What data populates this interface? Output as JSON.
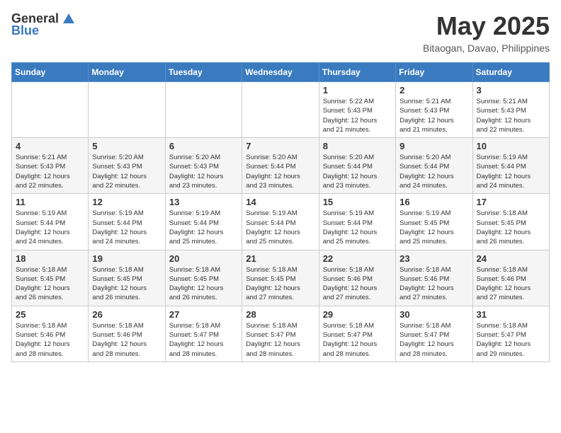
{
  "header": {
    "logo_general": "General",
    "logo_blue": "Blue",
    "month_title": "May 2025",
    "location": "Bitaogan, Davao, Philippines"
  },
  "days_of_week": [
    "Sunday",
    "Monday",
    "Tuesday",
    "Wednesday",
    "Thursday",
    "Friday",
    "Saturday"
  ],
  "weeks": [
    [
      {
        "day": "",
        "info": ""
      },
      {
        "day": "",
        "info": ""
      },
      {
        "day": "",
        "info": ""
      },
      {
        "day": "",
        "info": ""
      },
      {
        "day": "1",
        "info": "Sunrise: 5:22 AM\nSunset: 5:43 PM\nDaylight: 12 hours\nand 21 minutes."
      },
      {
        "day": "2",
        "info": "Sunrise: 5:21 AM\nSunset: 5:43 PM\nDaylight: 12 hours\nand 21 minutes."
      },
      {
        "day": "3",
        "info": "Sunrise: 5:21 AM\nSunset: 5:43 PM\nDaylight: 12 hours\nand 22 minutes."
      }
    ],
    [
      {
        "day": "4",
        "info": "Sunrise: 5:21 AM\nSunset: 5:43 PM\nDaylight: 12 hours\nand 22 minutes."
      },
      {
        "day": "5",
        "info": "Sunrise: 5:20 AM\nSunset: 5:43 PM\nDaylight: 12 hours\nand 22 minutes."
      },
      {
        "day": "6",
        "info": "Sunrise: 5:20 AM\nSunset: 5:43 PM\nDaylight: 12 hours\nand 23 minutes."
      },
      {
        "day": "7",
        "info": "Sunrise: 5:20 AM\nSunset: 5:44 PM\nDaylight: 12 hours\nand 23 minutes."
      },
      {
        "day": "8",
        "info": "Sunrise: 5:20 AM\nSunset: 5:44 PM\nDaylight: 12 hours\nand 23 minutes."
      },
      {
        "day": "9",
        "info": "Sunrise: 5:20 AM\nSunset: 5:44 PM\nDaylight: 12 hours\nand 24 minutes."
      },
      {
        "day": "10",
        "info": "Sunrise: 5:19 AM\nSunset: 5:44 PM\nDaylight: 12 hours\nand 24 minutes."
      }
    ],
    [
      {
        "day": "11",
        "info": "Sunrise: 5:19 AM\nSunset: 5:44 PM\nDaylight: 12 hours\nand 24 minutes."
      },
      {
        "day": "12",
        "info": "Sunrise: 5:19 AM\nSunset: 5:44 PM\nDaylight: 12 hours\nand 24 minutes."
      },
      {
        "day": "13",
        "info": "Sunrise: 5:19 AM\nSunset: 5:44 PM\nDaylight: 12 hours\nand 25 minutes."
      },
      {
        "day": "14",
        "info": "Sunrise: 5:19 AM\nSunset: 5:44 PM\nDaylight: 12 hours\nand 25 minutes."
      },
      {
        "day": "15",
        "info": "Sunrise: 5:19 AM\nSunset: 5:44 PM\nDaylight: 12 hours\nand 25 minutes."
      },
      {
        "day": "16",
        "info": "Sunrise: 5:19 AM\nSunset: 5:45 PM\nDaylight: 12 hours\nand 25 minutes."
      },
      {
        "day": "17",
        "info": "Sunrise: 5:18 AM\nSunset: 5:45 PM\nDaylight: 12 hours\nand 26 minutes."
      }
    ],
    [
      {
        "day": "18",
        "info": "Sunrise: 5:18 AM\nSunset: 5:45 PM\nDaylight: 12 hours\nand 26 minutes."
      },
      {
        "day": "19",
        "info": "Sunrise: 5:18 AM\nSunset: 5:45 PM\nDaylight: 12 hours\nand 26 minutes."
      },
      {
        "day": "20",
        "info": "Sunrise: 5:18 AM\nSunset: 5:45 PM\nDaylight: 12 hours\nand 26 minutes."
      },
      {
        "day": "21",
        "info": "Sunrise: 5:18 AM\nSunset: 5:45 PM\nDaylight: 12 hours\nand 27 minutes."
      },
      {
        "day": "22",
        "info": "Sunrise: 5:18 AM\nSunset: 5:46 PM\nDaylight: 12 hours\nand 27 minutes."
      },
      {
        "day": "23",
        "info": "Sunrise: 5:18 AM\nSunset: 5:46 PM\nDaylight: 12 hours\nand 27 minutes."
      },
      {
        "day": "24",
        "info": "Sunrise: 5:18 AM\nSunset: 5:46 PM\nDaylight: 12 hours\nand 27 minutes."
      }
    ],
    [
      {
        "day": "25",
        "info": "Sunrise: 5:18 AM\nSunset: 5:46 PM\nDaylight: 12 hours\nand 28 minutes."
      },
      {
        "day": "26",
        "info": "Sunrise: 5:18 AM\nSunset: 5:46 PM\nDaylight: 12 hours\nand 28 minutes."
      },
      {
        "day": "27",
        "info": "Sunrise: 5:18 AM\nSunset: 5:47 PM\nDaylight: 12 hours\nand 28 minutes."
      },
      {
        "day": "28",
        "info": "Sunrise: 5:18 AM\nSunset: 5:47 PM\nDaylight: 12 hours\nand 28 minutes."
      },
      {
        "day": "29",
        "info": "Sunrise: 5:18 AM\nSunset: 5:47 PM\nDaylight: 12 hours\nand 28 minutes."
      },
      {
        "day": "30",
        "info": "Sunrise: 5:18 AM\nSunset: 5:47 PM\nDaylight: 12 hours\nand 28 minutes."
      },
      {
        "day": "31",
        "info": "Sunrise: 5:18 AM\nSunset: 5:47 PM\nDaylight: 12 hours\nand 29 minutes."
      }
    ]
  ]
}
